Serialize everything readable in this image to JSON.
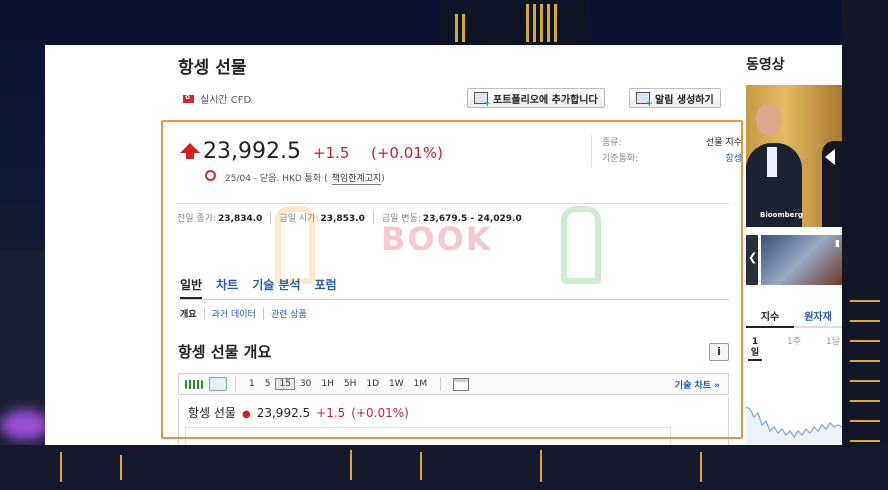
{
  "header": {
    "title": "항셍 선물",
    "subtitle": "실시간 CFD",
    "add_portfolio_label": "포트폴리오에 추가합니다",
    "create_alert_label": "알림 생성하기"
  },
  "quote": {
    "price": "23,992.5",
    "change": "+1.5",
    "change_pct": "(+0.01%)",
    "status": "25/04 - 닫음. HKD 통화 (",
    "disclaimer_link": "책임한계고지",
    "status_end": ")"
  },
  "meta": {
    "type_label": "종류:",
    "type_value": "선물 지수",
    "currency_label": "기준통화:",
    "currency_value": "항셍"
  },
  "stats": {
    "prev_close_label": "전일 종가:",
    "prev_close": "23,834.0",
    "open_label": "금일 시가:",
    "open": "23,853.0",
    "range_label": "금일 변동:",
    "range": "23,679.5 - 24,029.0"
  },
  "watermark": {
    "text": "BOOK"
  },
  "tabs": [
    "일반",
    "차트",
    "기술 분석",
    "포럼"
  ],
  "subtabs": [
    "개요",
    "과거 데이터",
    "관련 상품"
  ],
  "overview": {
    "title": "항셍 선물 개요",
    "info_icon": "i"
  },
  "chart_toolbar": {
    "timeframes": [
      "1",
      "5",
      "15",
      "30",
      "1H",
      "5H",
      "1D",
      "1W",
      "1M"
    ],
    "active": "15",
    "tech_chart_link": "기술 차트 »"
  },
  "quote_line": {
    "name": "항셍 선물",
    "price": "23,992.5",
    "change": "+1.5",
    "pct": "(+0.01%)"
  },
  "sidebar": {
    "video_title": "동영상",
    "video_source": "Bloomberg",
    "tabs": [
      "지수",
      "원자재"
    ],
    "periods": [
      "1일",
      "1주",
      "1달"
    ]
  },
  "colors": {
    "up": "#c0272d",
    "link": "#2b5ba8",
    "highlight": "#e7954a"
  }
}
